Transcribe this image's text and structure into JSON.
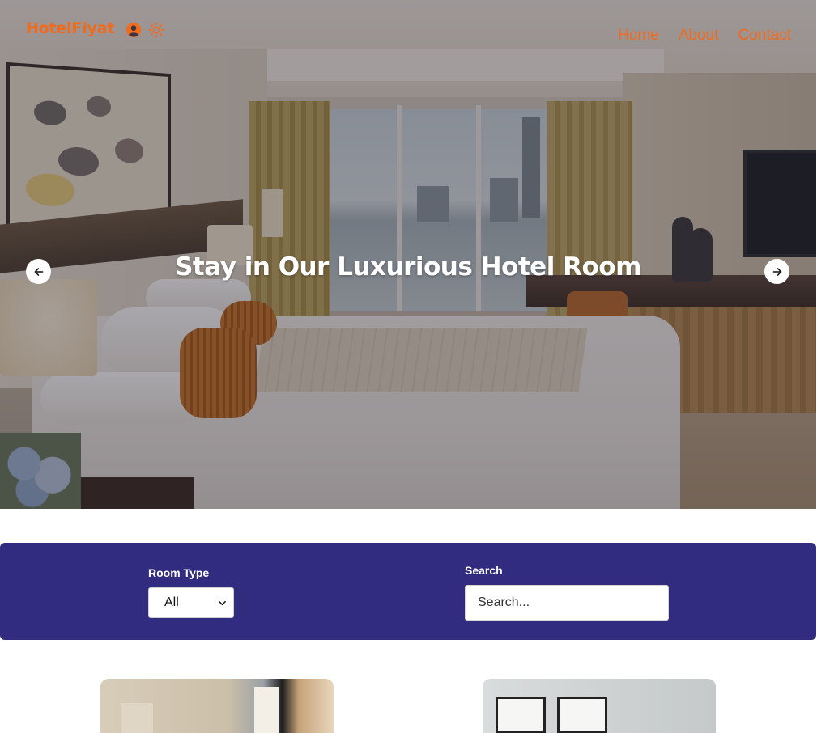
{
  "nav": {
    "brand": "HotelFiyat",
    "icons": [
      "user-circle-icon",
      "sun-icon"
    ],
    "links": [
      "Home",
      "About",
      "Contact"
    ],
    "accent_color": "#f26a1b"
  },
  "hero": {
    "title": "Stay in Our Luxurious Hotel Room",
    "prev_icon": "arrow-left-icon",
    "next_icon": "arrow-right-icon"
  },
  "filters": {
    "background_color": "#312c7f",
    "room_type_label": "Room Type",
    "room_type_value": "All",
    "room_type_options": [
      "All"
    ],
    "search_label": "Search",
    "search_placeholder": "Search..."
  }
}
